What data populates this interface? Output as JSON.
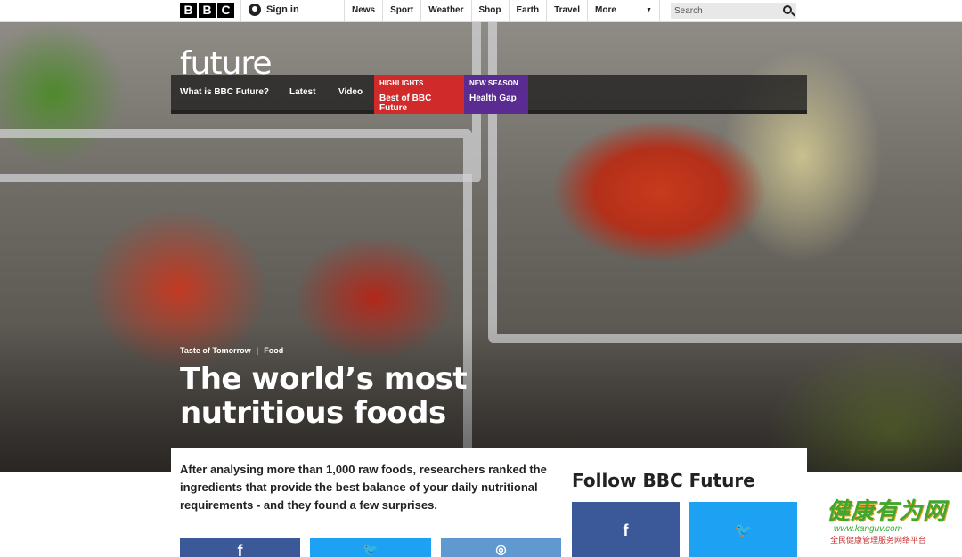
{
  "topbar": {
    "logo_letters": [
      "B",
      "B",
      "C"
    ],
    "signin_label": "Sign in",
    "nav_items": [
      "News",
      "Sport",
      "Weather",
      "Shop",
      "Earth",
      "Travel"
    ],
    "more_label": "More",
    "search_placeholder": "Search"
  },
  "future": {
    "logo_text": "future",
    "subnav": [
      "What is BBC Future?",
      "Latest",
      "Video"
    ],
    "promos": [
      {
        "kicker": "HIGHLIGHTS",
        "title": "Best of BBC Future",
        "color": "#d02a2a"
      },
      {
        "kicker": "NEW SEASON",
        "title": "Health Gap",
        "color": "#5a2c91"
      }
    ]
  },
  "article": {
    "tags": [
      "Taste of Tomorrow",
      "Food"
    ],
    "headline": "The world’s most nutritious foods",
    "summary": "After analysing more than 1,000 raw foods, researchers ranked the ingredients that provide the best balance of your daily nutritional requirements - and they found a few surprises.",
    "share_buttons": [
      {
        "icon": "facebook-icon",
        "glyph": "f",
        "color": "#3b5998"
      },
      {
        "icon": "twitter-icon",
        "glyph": "🐦",
        "color": "#1da1f2"
      },
      {
        "icon": "reddit-icon",
        "glyph": "◎",
        "color": "#5f99cf"
      }
    ]
  },
  "follow": {
    "title": "Follow BBC Future",
    "buttons": [
      {
        "icon": "facebook-icon",
        "glyph": "f",
        "color": "#3b5998"
      },
      {
        "icon": "twitter-icon",
        "glyph": "🐦",
        "color": "#1da1f2"
      }
    ]
  },
  "watermark": {
    "title": "健康有为网",
    "url": "www.kanguv.com",
    "subtitle": "全民健康管理服务网络平台"
  }
}
